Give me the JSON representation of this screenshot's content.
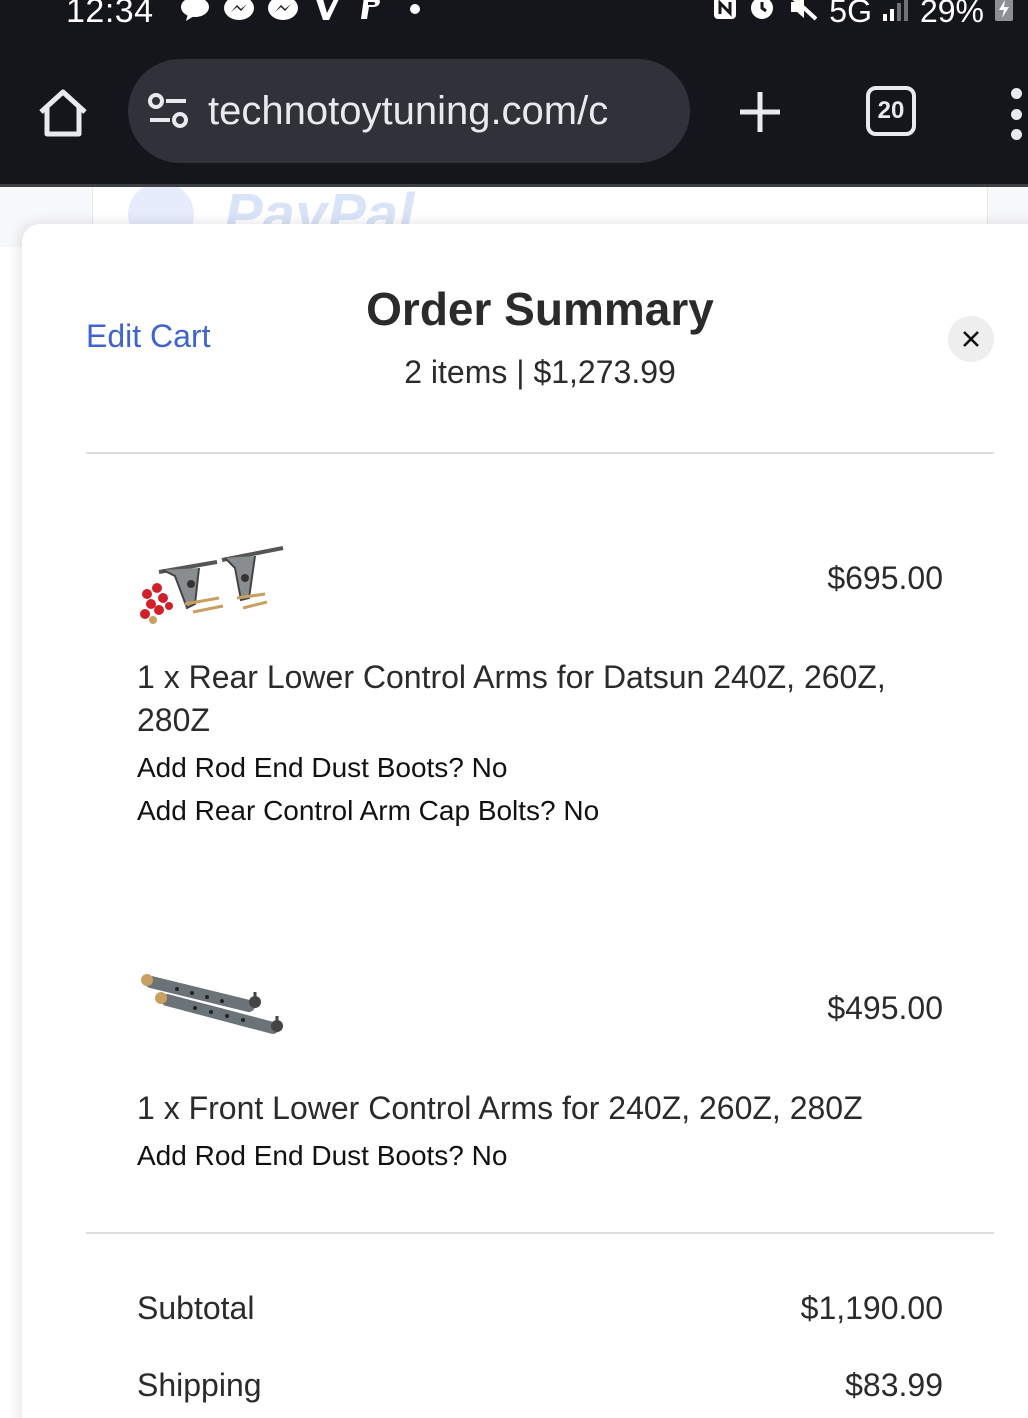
{
  "status_bar": {
    "time": "12:34",
    "network": "5G",
    "battery": "29%",
    "left_icons": [
      "chat-bubble-icon",
      "messenger-icon",
      "messenger-icon",
      "venmo-icon",
      "paypal-icon",
      "dot-icon"
    ],
    "right_icons": [
      "nfc-icon",
      "alarm-icon",
      "mute-icon",
      "signal-icon",
      "battery-charging-icon"
    ]
  },
  "browser": {
    "url": "technotoytuning.com/c",
    "tab_count": "20",
    "icons": [
      "home-icon",
      "site-settings-icon",
      "new-tab-icon",
      "menu-icon"
    ]
  },
  "background_page": {
    "brand": "PayPal"
  },
  "order_summary": {
    "edit_cart_label": "Edit Cart",
    "title": "Order Summary",
    "subtitle": "2 items | $1,273.99",
    "close_icon": "close-icon",
    "items": [
      {
        "price": "$695.00",
        "title": "1 x Rear Lower Control Arms for Datsun 240Z, 260Z, 280Z",
        "options": [
          "Add Rod End Dust Boots? No",
          "Add Rear Control Arm Cap Bolts? No"
        ]
      },
      {
        "price": "$495.00",
        "title": "1 x Front Lower Control Arms for 240Z, 260Z, 280Z",
        "options": [
          "Add Rod End Dust Boots? No"
        ]
      }
    ],
    "totals": [
      {
        "label": "Subtotal",
        "value": "$1,190.00"
      },
      {
        "label": "Shipping",
        "value": "$83.99"
      }
    ]
  },
  "colors": {
    "chrome_bg": "#14161b",
    "url_pill": "#2f3238",
    "link_blue": "#3f63cf",
    "text": "#2b2b2b",
    "accent_red": "#d0202a"
  }
}
